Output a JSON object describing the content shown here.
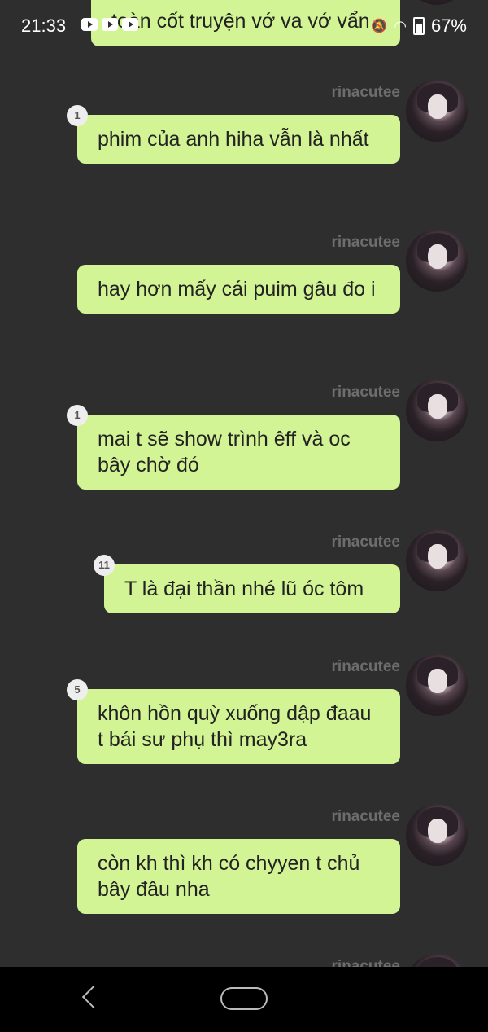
{
  "status_bar": {
    "time": "21:33",
    "battery": "67%"
  },
  "messages": [
    {
      "username": "rinacutee",
      "text": "toàn cốt truyện vớ va vớ vẩn",
      "badge": null
    },
    {
      "username": "rinacutee",
      "text": "phim của anh hiha vẫn là nhất",
      "badge": "1"
    },
    {
      "username": "rinacutee",
      "text": "hay hơn mấy cái puim gâu đo i",
      "badge": null
    },
    {
      "username": "rinacutee",
      "text": "mai t sẽ show trình êff và oc bây chờ đó",
      "badge": "1"
    },
    {
      "username": "rinacutee",
      "text": "T là đại thần nhé lũ óc tôm",
      "badge": "11"
    },
    {
      "username": "rinacutee",
      "text": "khôn hồn quỳ xuống dập đaau t bái sư phụ thì may3ra",
      "badge": "5"
    },
    {
      "username": "rinacutee",
      "text": "còn kh thì kh có chyyen t chủ bây đâu nha",
      "badge": null
    },
    {
      "username": "rinacutee",
      "text": "",
      "badge": null
    }
  ]
}
